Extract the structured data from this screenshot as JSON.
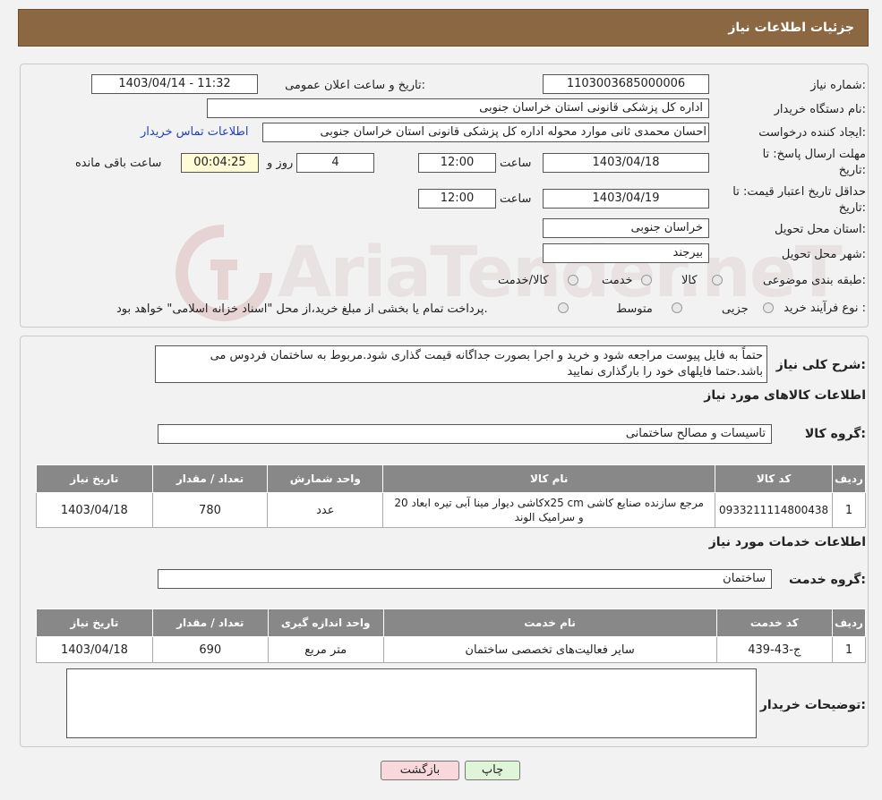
{
  "header": {
    "title": "جزئیات اطلاعات نیاز"
  },
  "form": {
    "need_number_label": "شماره نیاز:",
    "need_number": "1103003685000006",
    "announce_label": "تاریخ و ساعت اعلان عمومی:",
    "announce_value": "1403/04/14 - 11:32",
    "buyer_org_label": "نام دستگاه خریدار:",
    "buyer_org": "اداره کل پزشکی قانونی استان خراسان جنوبی",
    "creator_label": "ایجاد کننده درخواست:",
    "creator": "احسان محمدی ثانی موارد محوله اداره کل پزشکی قانونی استان خراسان جنوبی",
    "contact_link": "اطلاعات تماس خریدار",
    "deadline_label_1": "مهلت ارسال پاسخ: تا",
    "deadline_label_2": "تاریخ:",
    "deadline_date": "1403/04/18",
    "time_label": "ساعت",
    "deadline_time": "12:00",
    "days": "4",
    "days_label": "روز و",
    "remaining": "00:04:25",
    "remaining_label": "ساعت باقی مانده",
    "price_validity_label_1": "حداقل تاریخ اعتبار قیمت: تا",
    "price_validity_label_2": "تاریخ:",
    "price_validity_date": "1403/04/19",
    "price_validity_time": "12:00",
    "province_label": "استان محل تحویل:",
    "province": "خراسان جنوبی",
    "city_label": "شهر محل تحویل:",
    "city": "بیرجند",
    "category_label": "طبقه بندی موضوعی:",
    "category_options": [
      "کالا",
      "خدمت",
      "کالا/خدمت"
    ],
    "process_label": "نوع فرآیند خرید :",
    "process_options": [
      "جزیی",
      "متوسط"
    ],
    "process_note": "پرداخت تمام یا بخشی از مبلغ خرید،از محل \"اسناد خزانه اسلامی\" خواهد بود."
  },
  "description": {
    "label": "شرح کلی نیاز:",
    "text": "حتماً به فایل پیوست مراجعه شود و خرید و اجرا بصورت جداگانه قیمت گذاری شود.مربوط به ساختمان فردوس می باشد.حتما فایلهای خود را بارگذاری نمایید"
  },
  "goods": {
    "section_title": "اطلاعات کالاهای مورد نیاز",
    "group_label": "گروه کالا:",
    "group_value": "تاسیسات و مصالح ساختمانی",
    "columns": [
      "ردیف",
      "کد کالا",
      "نام کالا",
      "واحد شمارش",
      "تعداد / مقدار",
      "تاریخ نیاز"
    ],
    "rows": [
      {
        "row": "1",
        "code": "0933211114800438",
        "name": "کاشی دیوار مینا آبی تیره ابعاد 20x25 cm مرجع سازنده صنایع کاشی و سرامیک الوند",
        "unit": "عدد",
        "qty": "780",
        "date": "1403/04/18"
      }
    ]
  },
  "services": {
    "section_title": "اطلاعات خدمات مورد نیاز",
    "group_label": "گروه خدمت:",
    "group_value": "ساختمان",
    "columns": [
      "ردیف",
      "کد خدمت",
      "نام خدمت",
      "واحد اندازه گیری",
      "تعداد / مقدار",
      "تاریخ نیاز"
    ],
    "rows": [
      {
        "row": "1",
        "code": "ج-43-439",
        "name": "سایر فعالیت‌های تخصصی ساختمان",
        "unit": "متر مربع",
        "qty": "690",
        "date": "1403/04/18"
      }
    ]
  },
  "buyer_notes": {
    "label": "توضیحات خریدار:",
    "text": ""
  },
  "buttons": {
    "print": "چاپ",
    "back": "بازگشت"
  },
  "watermark": "AriaTender.neT"
}
